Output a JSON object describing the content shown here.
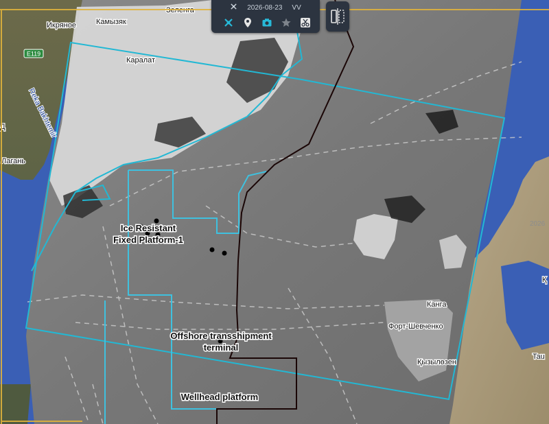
{
  "toolbar": {
    "date": "2026-08-23",
    "polarization": "VV",
    "buttons": [
      {
        "icon": "satellite-icon"
      },
      {
        "icon": "location-pin-icon"
      },
      {
        "icon": "camera-icon"
      },
      {
        "icon": "star-icon"
      },
      {
        "icon": "scissors-icon"
      }
    ]
  },
  "map_labels": {
    "zelenga": "Зеленга",
    "ikryanoe": "Икряное",
    "kamyzyak": "Камызяк",
    "road": "E119",
    "karalat": "Каралат",
    "river": "Reka Bakhtemir",
    "lagan": "Лагань",
    "kanga": "Канга",
    "fort": "Форт-Шевченко",
    "kyzylozen": "Қызылөзен",
    "tau": "Tau",
    "k_edge": "Қ",
    "d_edge": "Д",
    "faint_num": "2026"
  },
  "features": {
    "ice_platform_l1": "Ice Resistant",
    "ice_platform_l2": "Fixed Platform-1",
    "transship_l1": "Offshore transshipment",
    "transship_l2": "terminal",
    "wellhead": "Wellhead platform"
  },
  "colors": {
    "aoi_outline": "#22b8d4",
    "block_outline": "#3fc1df",
    "route_line": "#1a0606",
    "map_frame": "#e0b23c",
    "sea": "#3a5fb5",
    "sar_gray": "#7d7d7d"
  }
}
